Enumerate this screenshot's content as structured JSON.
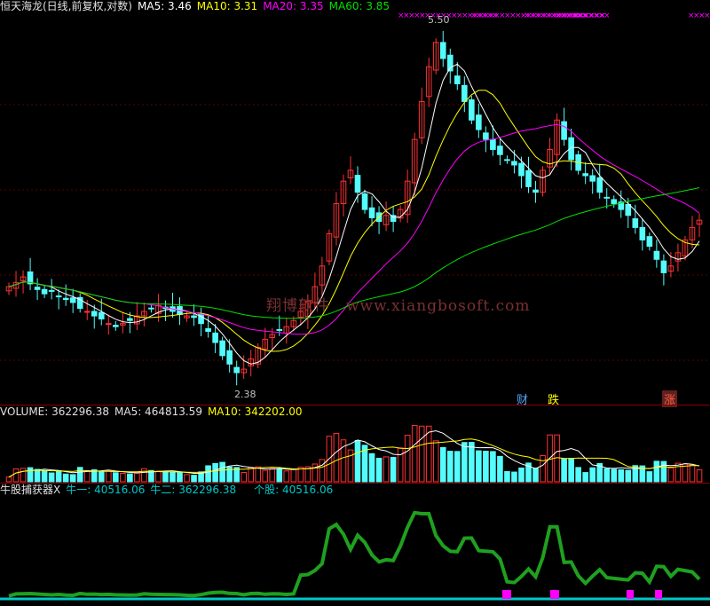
{
  "price_legend": {
    "title": "恒天海龙(日线,前复权,对数)",
    "ma5": "MA5: 3.46",
    "ma10": "MA10: 3.31",
    "ma20": "MA20: 3.35",
    "ma60": "MA60: 3.85"
  },
  "price_annotations": {
    "high": "5.50",
    "low": "2.38"
  },
  "watermark": {
    "cn": "翔博软件",
    "url": "www.xiangbosoft.com"
  },
  "markers": {
    "cai": "财",
    "die": "跌",
    "zhang": "涨"
  },
  "volume_legend": {
    "volume": "VOLUME: 362296.38",
    "ma5": "MA5: 464813.59",
    "ma10": "MA10: 342202.00"
  },
  "indicator_legend": {
    "name": "牛股捕获器X",
    "niu1": "牛一: 40516.06",
    "niu2": "牛二: 362296.38",
    "gegu": "个股: 40516.06"
  },
  "colors": {
    "up": "#ff3232",
    "down": "#54fcfc",
    "ma5": "#ffffff",
    "ma10": "#ffff00",
    "ma20": "#ff00ff",
    "ma60": "#00e000",
    "indicator": "#1fa01f",
    "baseline": "#00c8c8"
  },
  "chart_data": {
    "type": "candlestick",
    "price_scale": "log",
    "price_range": [
      2.38,
      5.5
    ],
    "closes": [
      2.95,
      2.98,
      3.02,
      2.97,
      2.93,
      2.9,
      2.92,
      2.88,
      2.86,
      2.84,
      2.8,
      2.78,
      2.75,
      2.73,
      2.7,
      2.68,
      2.7,
      2.72,
      2.75,
      2.78,
      2.8,
      2.82,
      2.8,
      2.78,
      2.76,
      2.75,
      2.74,
      2.7,
      2.65,
      2.58,
      2.5,
      2.45,
      2.4,
      2.42,
      2.48,
      2.55,
      2.6,
      2.63,
      2.66,
      2.68,
      2.72,
      2.78,
      2.85,
      2.95,
      3.1,
      3.35,
      3.6,
      3.8,
      3.9,
      3.7,
      3.55,
      3.48,
      3.45,
      3.5,
      3.45,
      3.55,
      3.8,
      4.2,
      4.6,
      5.0,
      5.3,
      5.1,
      4.95,
      4.8,
      4.6,
      4.4,
      4.3,
      4.2,
      4.1,
      4.05,
      4.0,
      3.95,
      3.85,
      3.75,
      3.7,
      3.9,
      4.1,
      4.4,
      4.2,
      4.0,
      3.9,
      3.85,
      3.8,
      3.7,
      3.65,
      3.6,
      3.55,
      3.5,
      3.4,
      3.3,
      3.25,
      3.15,
      3.05,
      3.1,
      3.2,
      3.3,
      3.4,
      3.46
    ]
  }
}
